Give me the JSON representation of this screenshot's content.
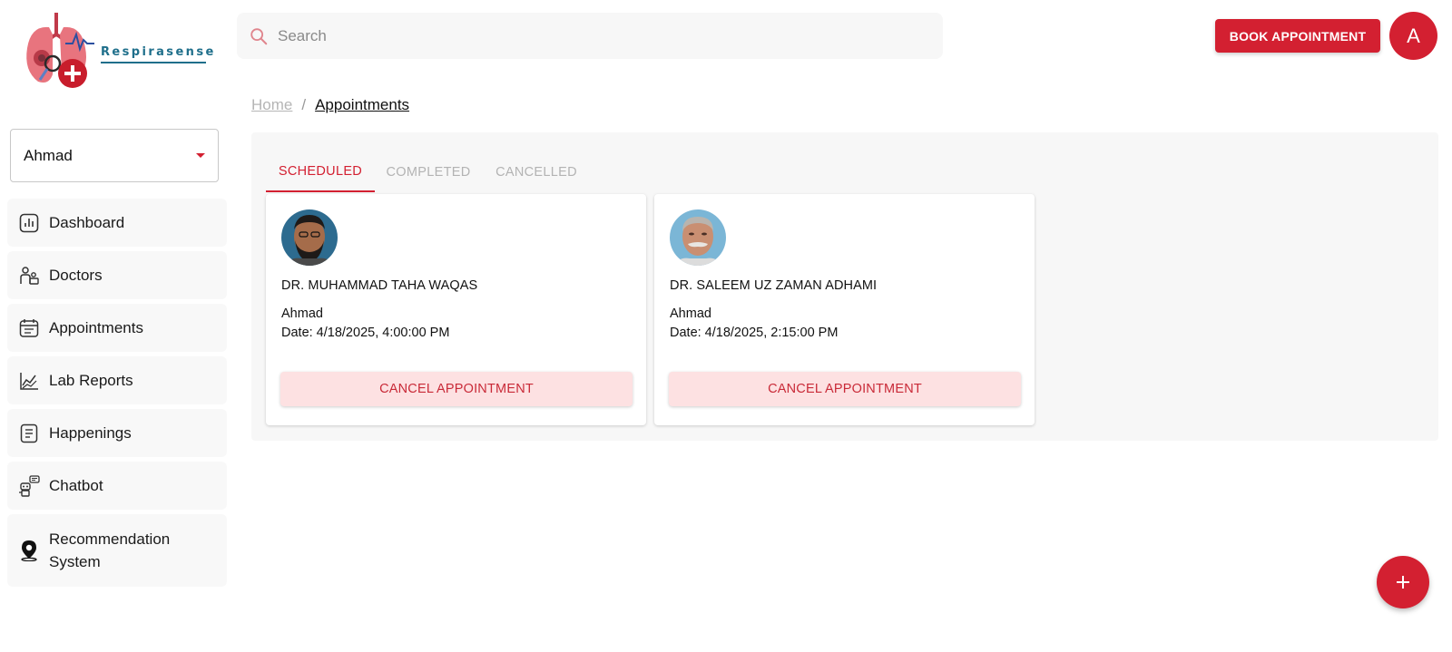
{
  "brand": {
    "name": "Respirasense"
  },
  "search": {
    "placeholder": "Search"
  },
  "header": {
    "book_label": "BOOK APPOINTMENT",
    "avatar_initial": "A"
  },
  "sidebar": {
    "user_select": "Ahmad",
    "items": [
      {
        "label": "Dashboard",
        "icon": "chart-bar-icon"
      },
      {
        "label": "Doctors",
        "icon": "doctor-icon"
      },
      {
        "label": "Appointments",
        "icon": "calendar-icon"
      },
      {
        "label": "Lab Reports",
        "icon": "line-chart-icon"
      },
      {
        "label": "Happenings",
        "icon": "document-icon"
      },
      {
        "label": "Chatbot",
        "icon": "robot-icon"
      },
      {
        "label": "Recommendation System",
        "icon": "location-pin-icon"
      }
    ]
  },
  "breadcrumb": {
    "home": "Home",
    "separator": "/",
    "current": "Appointments"
  },
  "tabs": [
    {
      "label": "SCHEDULED",
      "active": true
    },
    {
      "label": "COMPLETED",
      "active": false
    },
    {
      "label": "CANCELLED",
      "active": false
    }
  ],
  "appointments": [
    {
      "doctor": "DR. MUHAMMAD TAHA WAQAS",
      "patient": "Ahmad",
      "date": "Date: 4/18/2025, 4:00:00 PM",
      "cancel_label": "CANCEL APPOINTMENT"
    },
    {
      "doctor": "DR. SALEEM UZ ZAMAN ADHAMI",
      "patient": "Ahmad",
      "date": "Date: 4/18/2025, 2:15:00 PM",
      "cancel_label": "CANCEL APPOINTMENT"
    }
  ],
  "colors": {
    "accent": "#d32031",
    "cancel_bg": "#fde1e2",
    "brand_text": "#1f6f8b"
  }
}
